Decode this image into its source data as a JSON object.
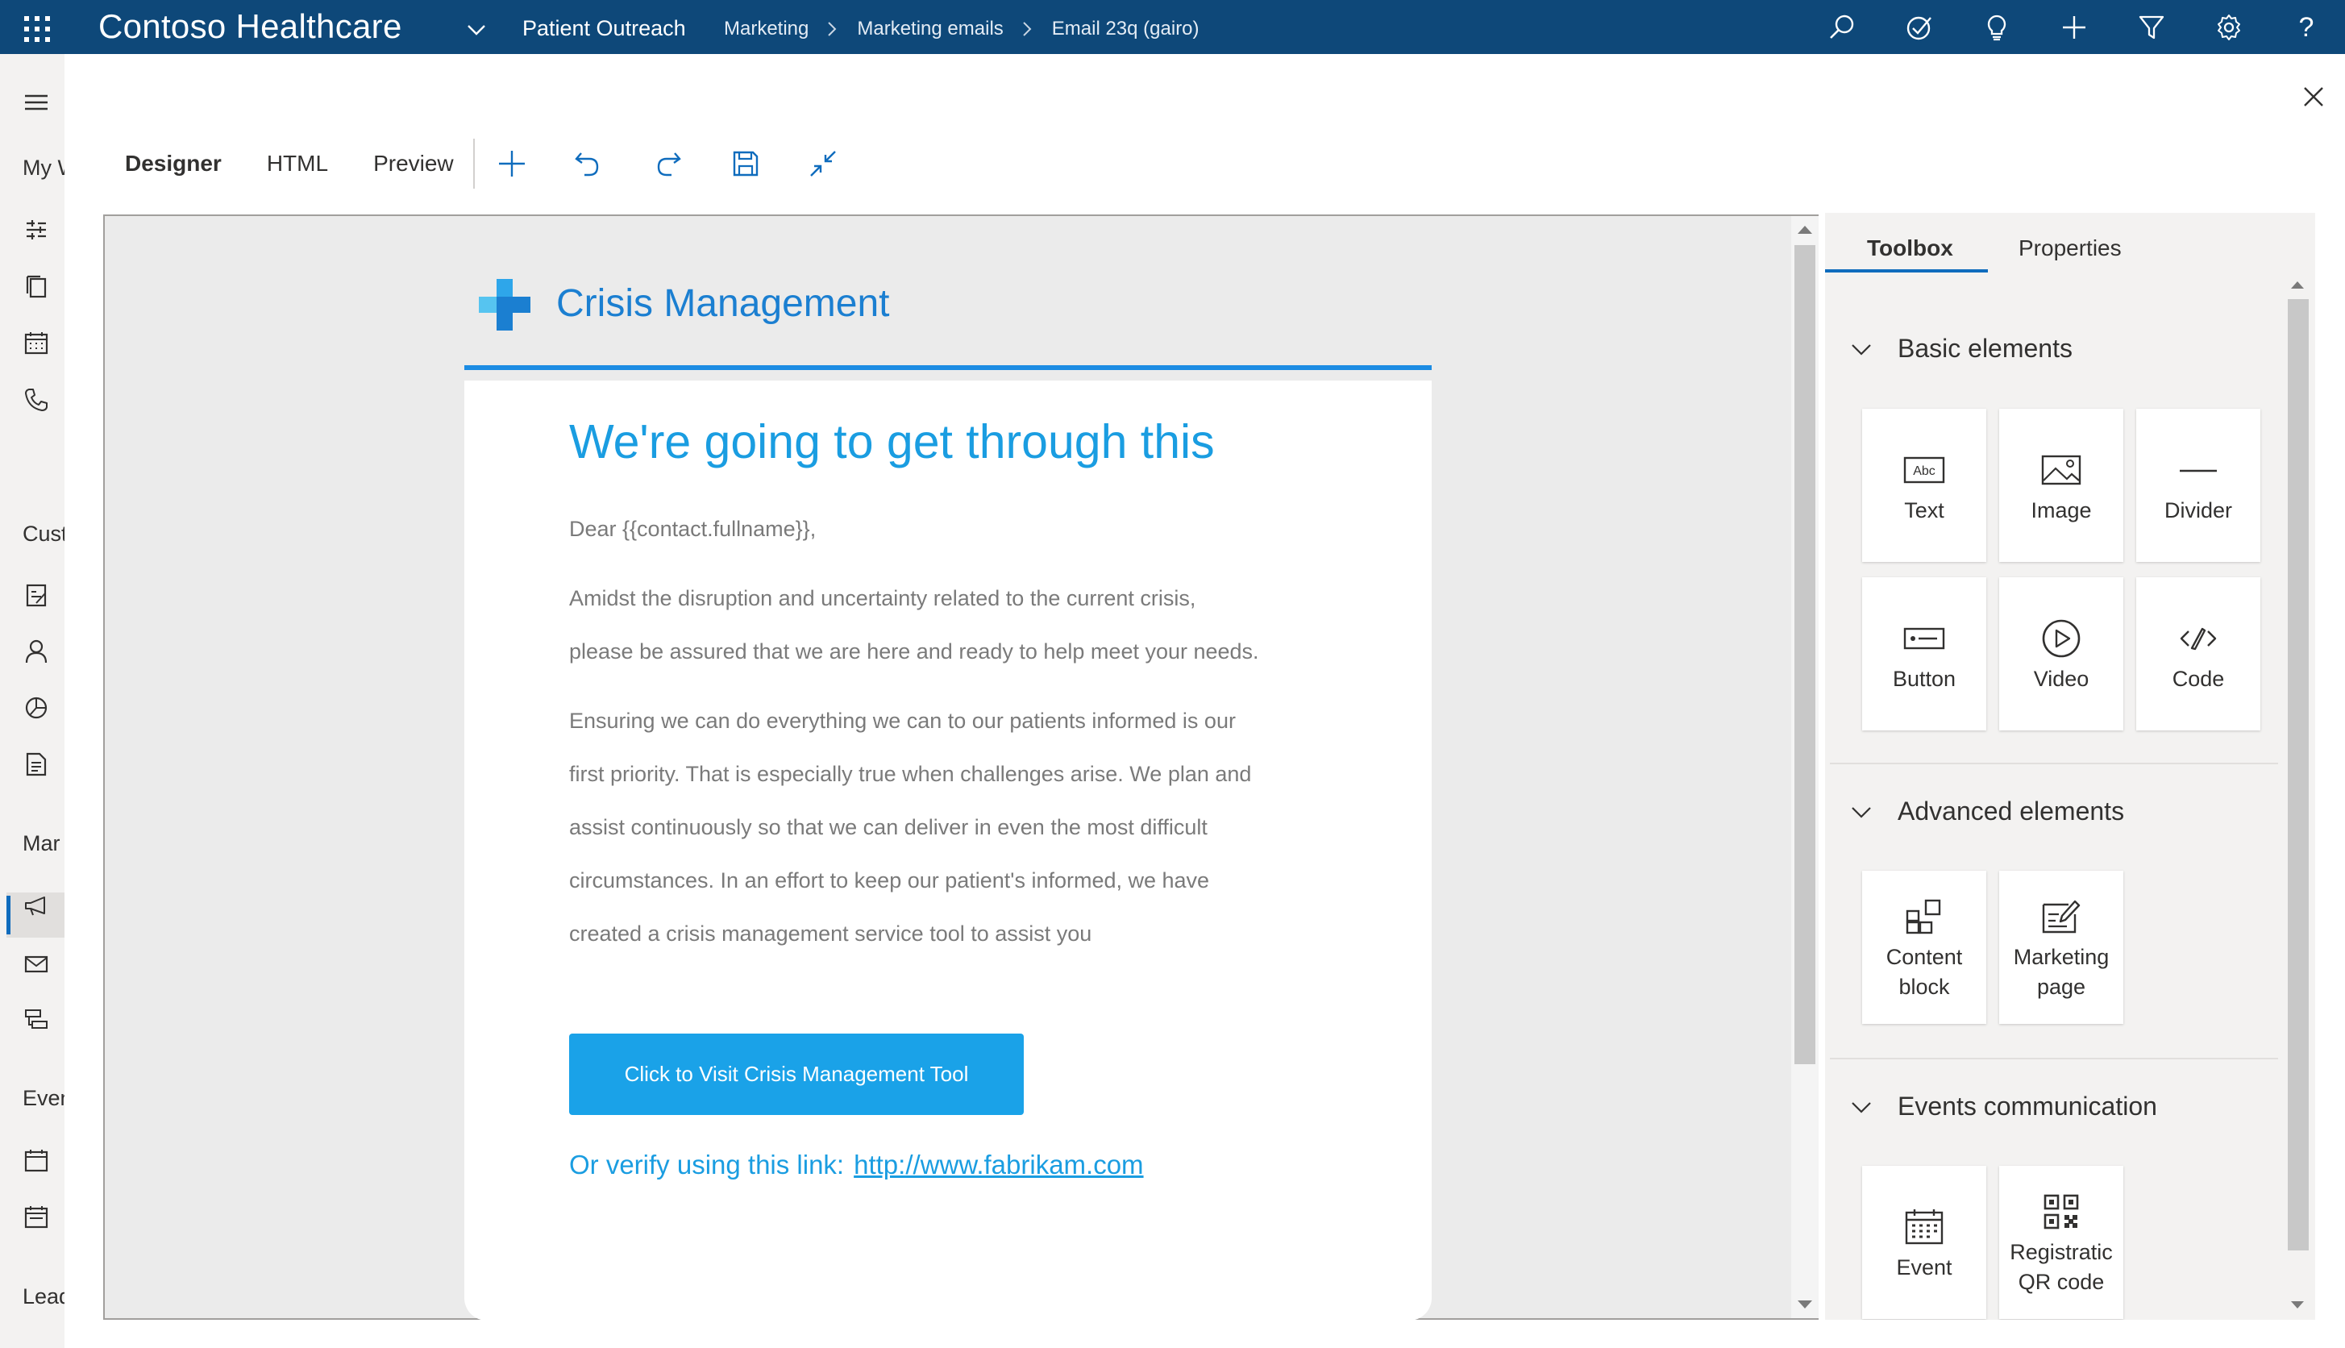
{
  "topbar": {
    "app_name": "Contoso Healthcare",
    "area": "Patient Outreach",
    "breadcrumbs": [
      "Marketing",
      "Marketing emails",
      "Email 23q (gairo)"
    ],
    "icons": [
      "search-icon",
      "task-icon",
      "lightbulb-icon",
      "add-icon",
      "filter-icon",
      "settings-icon",
      "help-icon"
    ],
    "help_glyph": "?",
    "color": "#0e4879"
  },
  "leftnav": {
    "headings": [
      "My W",
      "Cust",
      "Mar",
      "Even",
      "Lead"
    ],
    "icons": [
      "hamburger-icon",
      "dashboard-icon",
      "pages-icon",
      "calendar-icon",
      "phone-icon",
      "account-icon",
      "person-icon",
      "segment-icon",
      "report-icon",
      "megaphone-icon",
      "mail-icon",
      "journey-icon",
      "event-icon",
      "calendar-icon",
      "lead-icon"
    ],
    "selected": "mail-icon"
  },
  "toolbar": {
    "tabs": [
      "Designer",
      "HTML",
      "Preview"
    ],
    "active_tab": "Designer",
    "icons": [
      "add-icon",
      "undo-icon",
      "redo-icon",
      "save-icon",
      "collapse-icon"
    ]
  },
  "email": {
    "brand_name": "Crisis Management",
    "headline": "We're going to get through this",
    "greeting": "Dear {{contact.fullname}},",
    "paragraph1": [
      "Amidst the disruption and uncertainty related to the current crisis,",
      "please be assured that we are here and ready to help meet your needs."
    ],
    "paragraph2": [
      "Ensuring we can do everything we can to our patients informed is our",
      "first priority. That is especially true when challenges arise. We plan and",
      "assist continuously so that we can deliver in even the most difficult",
      "circumstances. In an effort to keep our patient's informed, we have",
      "created a crisis management service tool to assist you"
    ],
    "cta_label": "Click to Visit Crisis Management Tool",
    "verify_text": "Or verify using this link:",
    "verify_link": "http://www.fabrikam.com",
    "accent_color": "#1a9de1",
    "button_color": "#1aa2e8"
  },
  "panel": {
    "tabs": [
      "Toolbox",
      "Properties"
    ],
    "active_tab": "Toolbox",
    "sections": [
      {
        "title": "Basic elements",
        "items": [
          {
            "label": "Text",
            "icon": "text-icon"
          },
          {
            "label": "Image",
            "icon": "image-icon"
          },
          {
            "label": "Divider",
            "icon": "divider-icon"
          },
          {
            "label": "Button",
            "icon": "button-icon"
          },
          {
            "label": "Video",
            "icon": "video-icon"
          },
          {
            "label": "Code",
            "icon": "code-icon"
          }
        ]
      },
      {
        "title": "Advanced elements",
        "items": [
          {
            "label": "Content\nblock",
            "icon": "content-block-icon"
          },
          {
            "label": "Marketing\npage",
            "icon": "marketing-page-icon"
          }
        ]
      },
      {
        "title": "Events communication",
        "items": [
          {
            "label": "Event",
            "icon": "event-calendar-icon"
          },
          {
            "label": "Registratic\nQR code",
            "icon": "qr-code-icon"
          }
        ]
      }
    ]
  }
}
